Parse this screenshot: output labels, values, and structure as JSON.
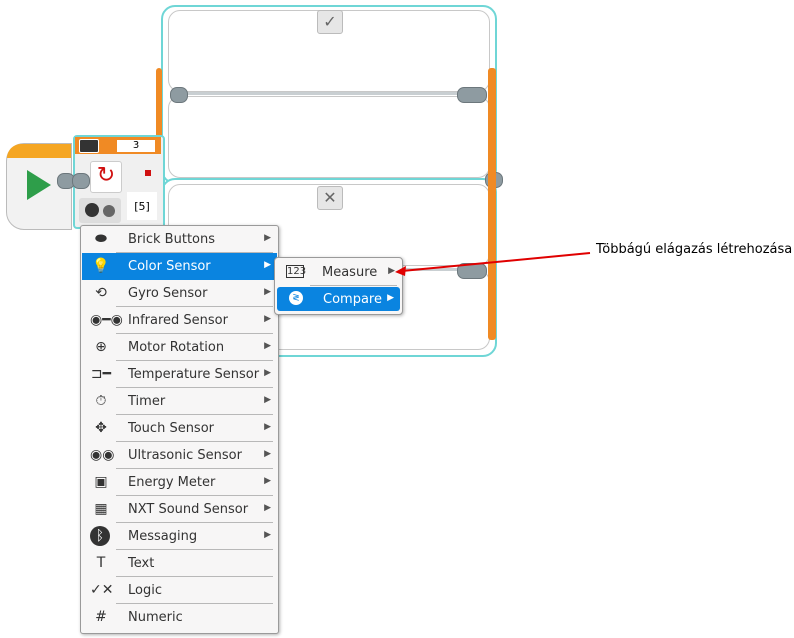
{
  "switch": {
    "case_true_icon": "check-icon",
    "case_false_icon": "x-icon",
    "count_value": "3",
    "port_value": "[5]"
  },
  "menu": {
    "items": [
      {
        "label": "Brick Buttons",
        "icon": "brick-buttons-icon",
        "submenu": true
      },
      {
        "label": "Color Sensor",
        "icon": "color-sensor-icon",
        "submenu": true,
        "selected": true
      },
      {
        "label": "Gyro Sensor",
        "icon": "gyro-sensor-icon",
        "submenu": true
      },
      {
        "label": "Infrared Sensor",
        "icon": "infrared-sensor-icon",
        "submenu": true
      },
      {
        "label": "Motor Rotation",
        "icon": "motor-rotation-icon",
        "submenu": true
      },
      {
        "label": "Temperature Sensor",
        "icon": "temperature-sensor-icon",
        "submenu": true
      },
      {
        "label": "Timer",
        "icon": "timer-icon",
        "submenu": true
      },
      {
        "label": "Touch Sensor",
        "icon": "touch-sensor-icon",
        "submenu": true
      },
      {
        "label": "Ultrasonic Sensor",
        "icon": "ultrasonic-sensor-icon",
        "submenu": true
      },
      {
        "label": "Energy Meter",
        "icon": "energy-meter-icon",
        "submenu": true
      },
      {
        "label": "NXT Sound Sensor",
        "icon": "sound-sensor-icon",
        "submenu": true
      },
      {
        "label": "Messaging",
        "icon": "bluetooth-icon",
        "submenu": true
      },
      {
        "label": "Text",
        "icon": "text-icon",
        "submenu": false
      },
      {
        "label": "Logic",
        "icon": "logic-icon",
        "submenu": false
      },
      {
        "label": "Numeric",
        "icon": "numeric-icon",
        "submenu": false
      }
    ]
  },
  "submenu": {
    "items": [
      {
        "label": "Measure",
        "icon": "measure-icon"
      },
      {
        "label": "Compare",
        "icon": "compare-icon",
        "selected": true
      }
    ]
  },
  "annotation": {
    "text": "Többágú elágazás létrehozása"
  },
  "colors": {
    "selection": "#0a84e0",
    "frame": "#6fd6d6",
    "orange": "#f08a24",
    "arrow": "#e00000"
  }
}
